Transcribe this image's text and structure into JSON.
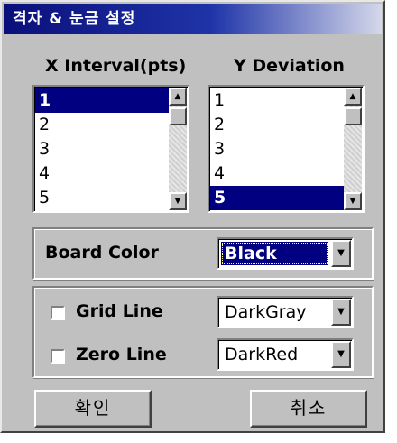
{
  "window": {
    "title": "격자 & 눈금 설정"
  },
  "x_list": {
    "header": "X Interval(pts)",
    "items": [
      "1",
      "2",
      "3",
      "4",
      "5"
    ],
    "selected": "1"
  },
  "y_list": {
    "header": "Y Deviation",
    "items": [
      "1",
      "2",
      "3",
      "4",
      "5"
    ],
    "selected": "5"
  },
  "board": {
    "label": "Board Color",
    "value": "Black"
  },
  "grid_line": {
    "label": "Grid  Line",
    "checked": false,
    "value": "DarkGray"
  },
  "zero_line": {
    "label": "Zero Line",
    "checked": false,
    "value": "DarkRed"
  },
  "buttons": {
    "ok": "확인",
    "cancel": "취소"
  },
  "colors": {
    "selection": "#000080",
    "face": "#c0c0c0",
    "title_start": "#0a0f7a"
  },
  "icons": {
    "scroll_up": "arrow-up-icon",
    "scroll_down": "arrow-down-icon",
    "dropdown": "chevron-down-icon"
  }
}
